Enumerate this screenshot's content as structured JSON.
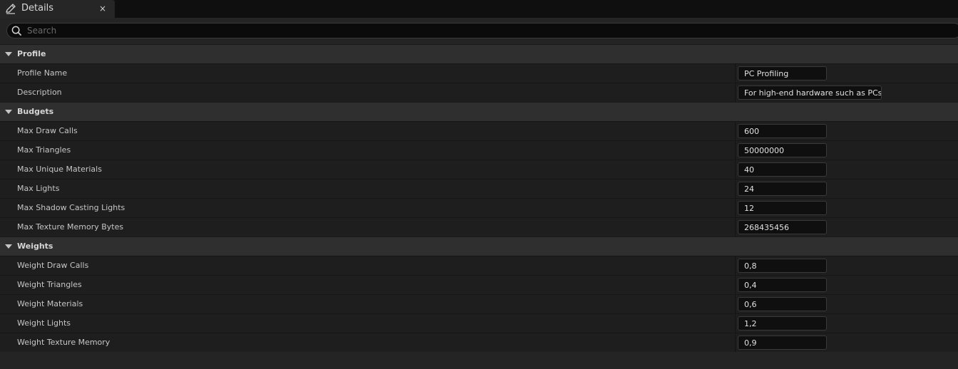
{
  "tab": {
    "title": "Details",
    "close": "×",
    "icon": "edit-pencil-icon"
  },
  "search": {
    "placeholder": "Search",
    "value": ""
  },
  "categories": [
    {
      "label": "Profile",
      "properties": [
        {
          "label": "Profile Name",
          "value": "PC Profiling"
        },
        {
          "label": "Description",
          "value": "For high-end hardware such as PCs"
        }
      ]
    },
    {
      "label": "Budgets",
      "properties": [
        {
          "label": "Max Draw Calls",
          "value": "600"
        },
        {
          "label": "Max Triangles",
          "value": "50000000"
        },
        {
          "label": "Max Unique Materials",
          "value": "40"
        },
        {
          "label": "Max Lights",
          "value": "24"
        },
        {
          "label": "Max Shadow Casting Lights",
          "value": "12"
        },
        {
          "label": "Max Texture Memory Bytes",
          "value": "268435456"
        }
      ]
    },
    {
      "label": "Weights",
      "properties": [
        {
          "label": "Weight Draw Calls",
          "value": "0,8"
        },
        {
          "label": "Weight Triangles",
          "value": "0,4"
        },
        {
          "label": "Weight Materials",
          "value": "0,6"
        },
        {
          "label": "Weight Lights",
          "value": "1,2"
        },
        {
          "label": "Weight Texture Memory",
          "value": "0,9"
        }
      ]
    }
  ],
  "colors": {
    "background": "#242424",
    "category_header": "#2f2f2f",
    "row": "#1e1e1e",
    "field": "#0f0f0f"
  }
}
